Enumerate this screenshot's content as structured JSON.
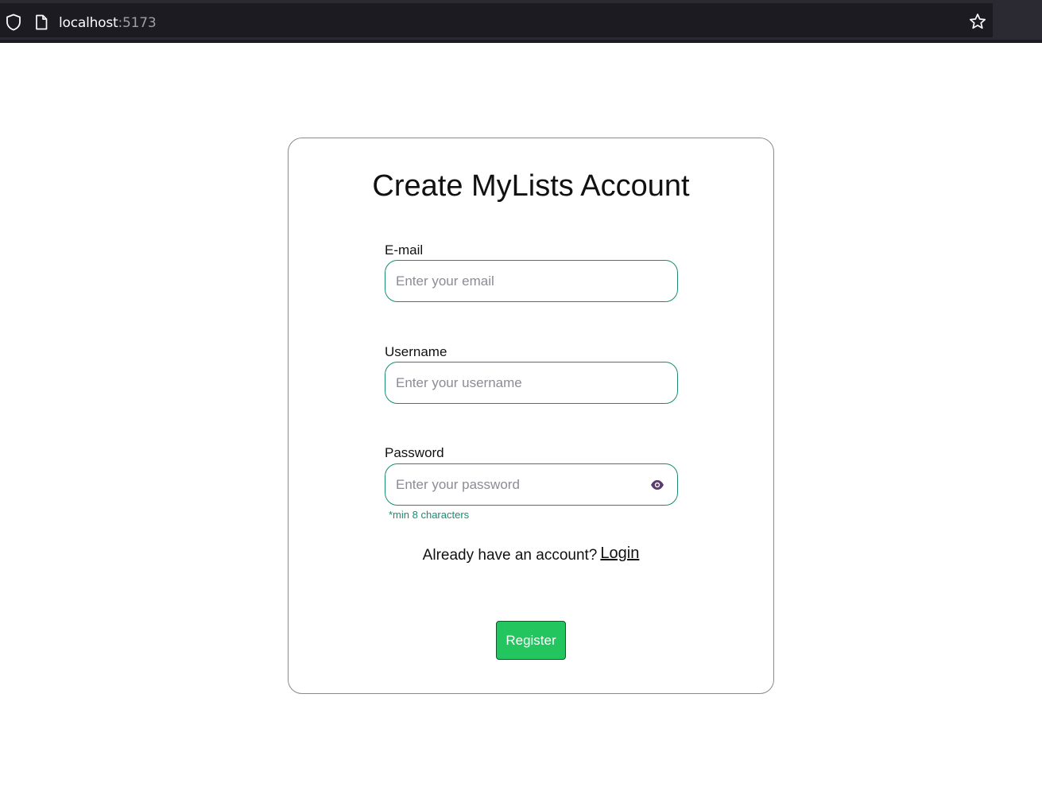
{
  "browser": {
    "url_host": "localhost",
    "url_port": ":5173",
    "icons": {
      "left": "shield-icon",
      "page": "page-icon",
      "right": "star-icon"
    }
  },
  "form": {
    "title": "Create MyLists Account",
    "email": {
      "label": "E-mail",
      "placeholder": "Enter your email",
      "value": ""
    },
    "username": {
      "label": "Username",
      "placeholder": "Enter your username",
      "value": ""
    },
    "password": {
      "label": "Password",
      "placeholder": "Enter your password",
      "value": "",
      "hint": "*min 8 characters",
      "toggle_icon": "eye-icon"
    },
    "login_prompt": "Already have an account?",
    "login_link": "Login",
    "register_label": "Register"
  },
  "colors": {
    "accent": "#1b8a74",
    "button": "#22c55e",
    "button_border": "#14532d",
    "eye_icon": "#5b3a6e"
  }
}
